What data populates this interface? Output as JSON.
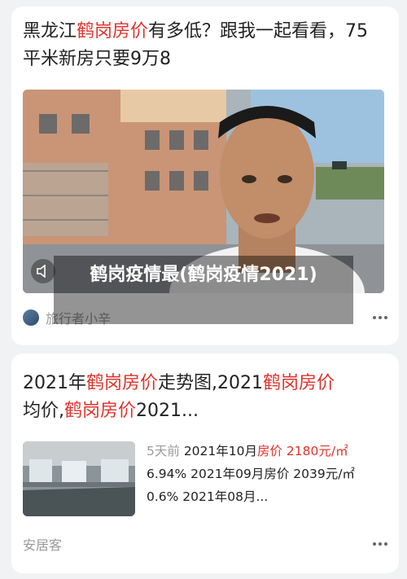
{
  "card1": {
    "title_prefix": "黑龙江",
    "title_highlight": "鹤岗房价",
    "title_suffix": "有多低？跟我一起看看，75平米新房只要9万8",
    "overlay_caption": "鹤岗疫情最(鹤岗疫情2021)",
    "author": "旅行者小辛",
    "icons": {
      "mute": "speaker-muted-icon",
      "more": "more-dots-icon"
    }
  },
  "card2": {
    "title_part1": "2021年",
    "title_hl1": "鹤岗房价",
    "title_part2": "走势图,2021",
    "title_hl2": "鹤岗房价",
    "title_part3": "均价,",
    "title_hl3": "鹤岗房价",
    "title_part4": "2021...",
    "time_ago": "5天前",
    "line1_prefix": "2021年10月",
    "line1_highlight": "房价 2180元/㎡",
    "line2": "6.94% 2021年09月房价 2039元/㎡",
    "line3": "0.6% 2021年08月...",
    "source": "安居客"
  },
  "colors": {
    "highlight": "#e0332b",
    "meta": "#9a9a9a",
    "background": "#f1f2f4"
  }
}
